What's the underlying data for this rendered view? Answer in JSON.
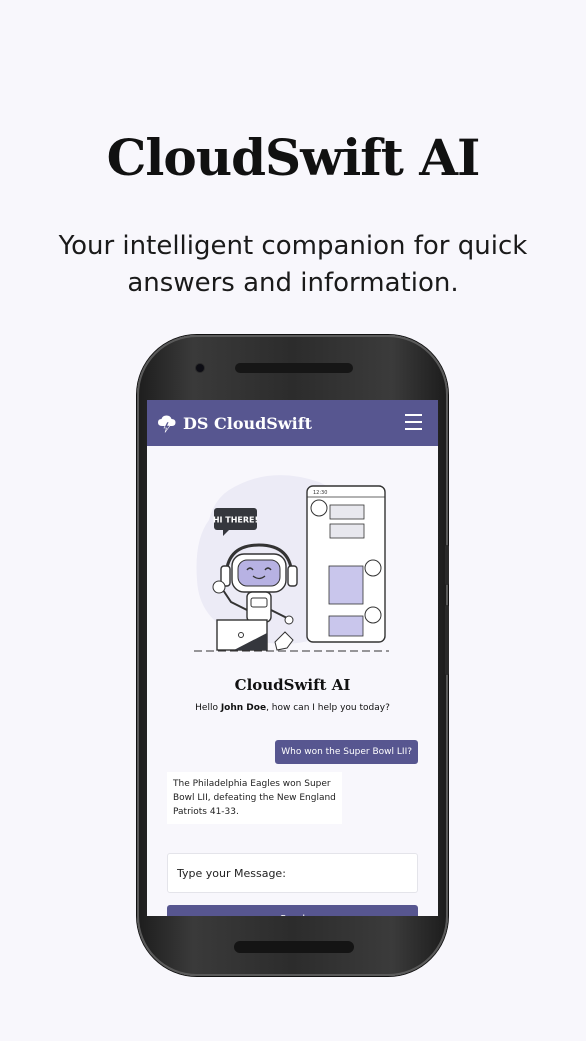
{
  "hero": {
    "title": "CloudSwift AI",
    "subtitle": "Your intelligent companion for quick answers and information."
  },
  "app": {
    "brand": "DS CloudSwift",
    "brand_icon": "cloud-lightning-icon",
    "menu_icon": "hamburger-menu-icon",
    "accent_color": "#575690"
  },
  "illustration": {
    "bubble_text": "HI THERE!",
    "phone_time": "12:30"
  },
  "chat": {
    "title": "CloudSwift AI",
    "greeting_prefix": "Hello ",
    "user_name": "John Doe",
    "greeting_suffix": ", how can I help you today?",
    "messages": [
      {
        "role": "user",
        "text": "Who won the Super Bowl LII?"
      },
      {
        "role": "bot",
        "text": "The Philadelphia Eagles won Super Bowl LII, defeating the New England Patriots 41-33."
      }
    ],
    "input_placeholder": "Type your Message:",
    "send_label": "Send"
  }
}
